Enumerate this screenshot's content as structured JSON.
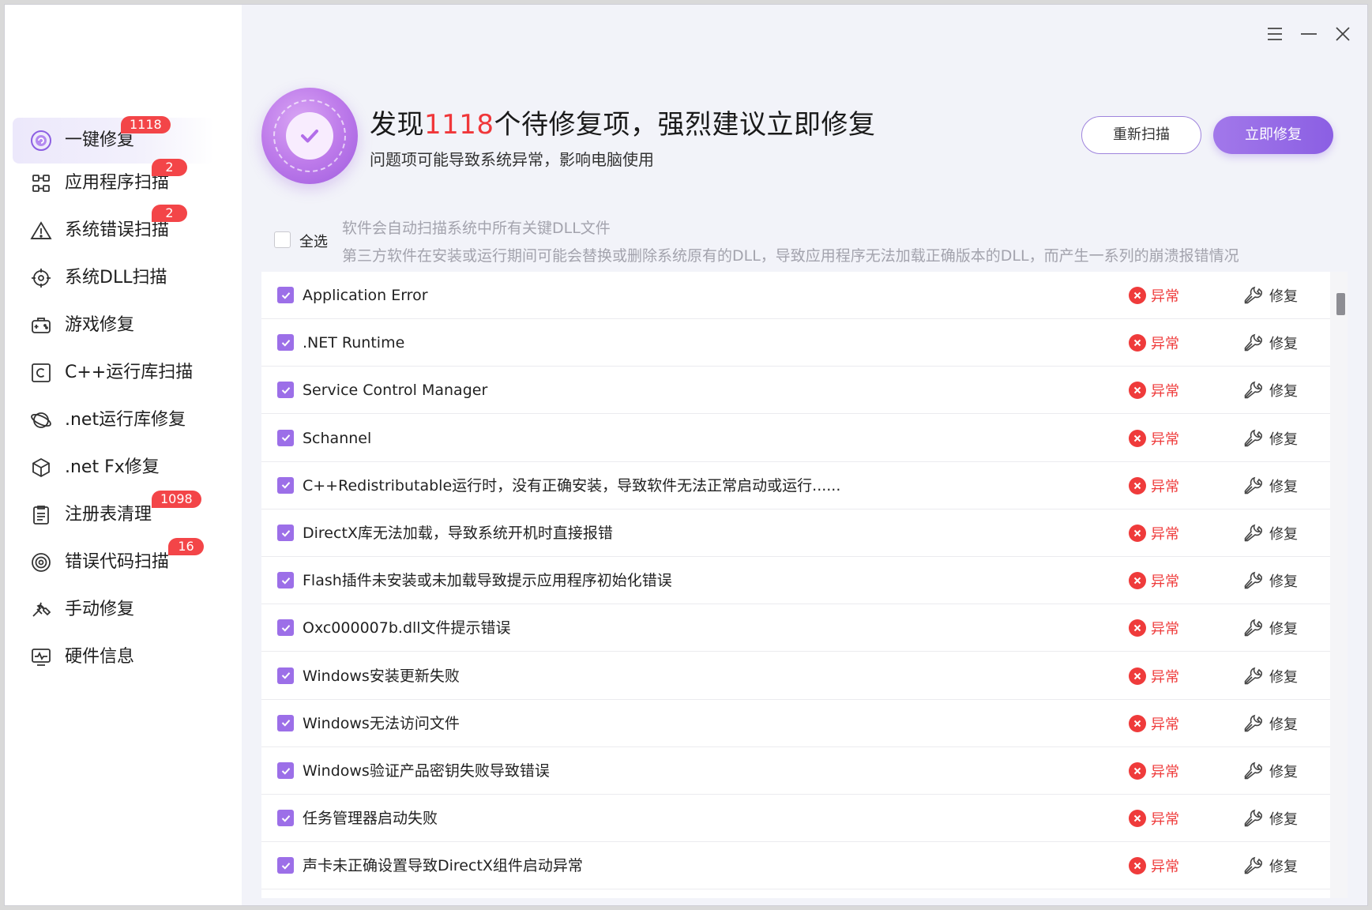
{
  "sidebar": {
    "items": [
      {
        "label": "一键修复",
        "badge": "1118",
        "icon": "one-click-repair-icon",
        "active": true
      },
      {
        "label": "应用程序扫描",
        "badge": "2",
        "icon": "app-scan-icon"
      },
      {
        "label": "系统错误扫描",
        "badge": "2",
        "icon": "warning-triangle-icon"
      },
      {
        "label": "系统DLL扫描",
        "badge": "",
        "icon": "target-gear-icon"
      },
      {
        "label": "游戏修复",
        "badge": "",
        "icon": "gamepad-icon"
      },
      {
        "label": "C++运行库扫描",
        "badge": "",
        "icon": "c-box-icon"
      },
      {
        "label": ".net运行库修复",
        "badge": "",
        "icon": "planet-icon"
      },
      {
        "label": ".net Fx修复",
        "badge": "",
        "icon": "cube-icon"
      },
      {
        "label": "注册表清理",
        "badge": "1098",
        "icon": "clipboard-list-icon"
      },
      {
        "label": "错误代码扫描",
        "badge": "16",
        "icon": "spiral-target-icon"
      },
      {
        "label": "手动修复",
        "badge": "",
        "icon": "hand-tool-icon"
      },
      {
        "label": "硬件信息",
        "badge": "",
        "icon": "monitor-pulse-icon"
      }
    ]
  },
  "header": {
    "title_prefix": "发现",
    "count": "1118",
    "title_suffix": "个待修复项，强烈建议立即修复",
    "subtitle": "问题项可能导致系统异常，影响电脑使用",
    "rescan_label": "重新扫描",
    "fix_now_label": "立即修复"
  },
  "select_all": {
    "label": "全选",
    "info_line1": "软件会自动扫描系统中所有关键DLL文件",
    "info_line2": "第三方软件在安装或运行期间可能会替换或删除系统原有的DLL，导致应用程序无法加载正确版本的DLL，而产生一系列的崩溃报错情况"
  },
  "list": {
    "status_text": "异常",
    "fix_text": "修复",
    "items": [
      "Application Error",
      ".NET Runtime",
      "Service Control Manager",
      "Schannel",
      "C++Redistributable运行时，没有正确安装，导致软件无法正常启动或运行......",
      "DirectX库无法加载，导致系统开机时直接报错",
      "Flash插件未安装或未加载导致提示应用程序初始化错误",
      "Oxc000007b.dll文件提示错误",
      "Windows安装更新失败",
      "Windows无法访问文件",
      "Windows验证产品密钥失败导致错误",
      "任务管理器启动失败",
      "声卡未正确设置导致DirectX组件启动异常"
    ]
  },
  "colors": {
    "accent": "#9c6fe8",
    "danger": "#ef3b3b",
    "badge": "#f34548"
  }
}
